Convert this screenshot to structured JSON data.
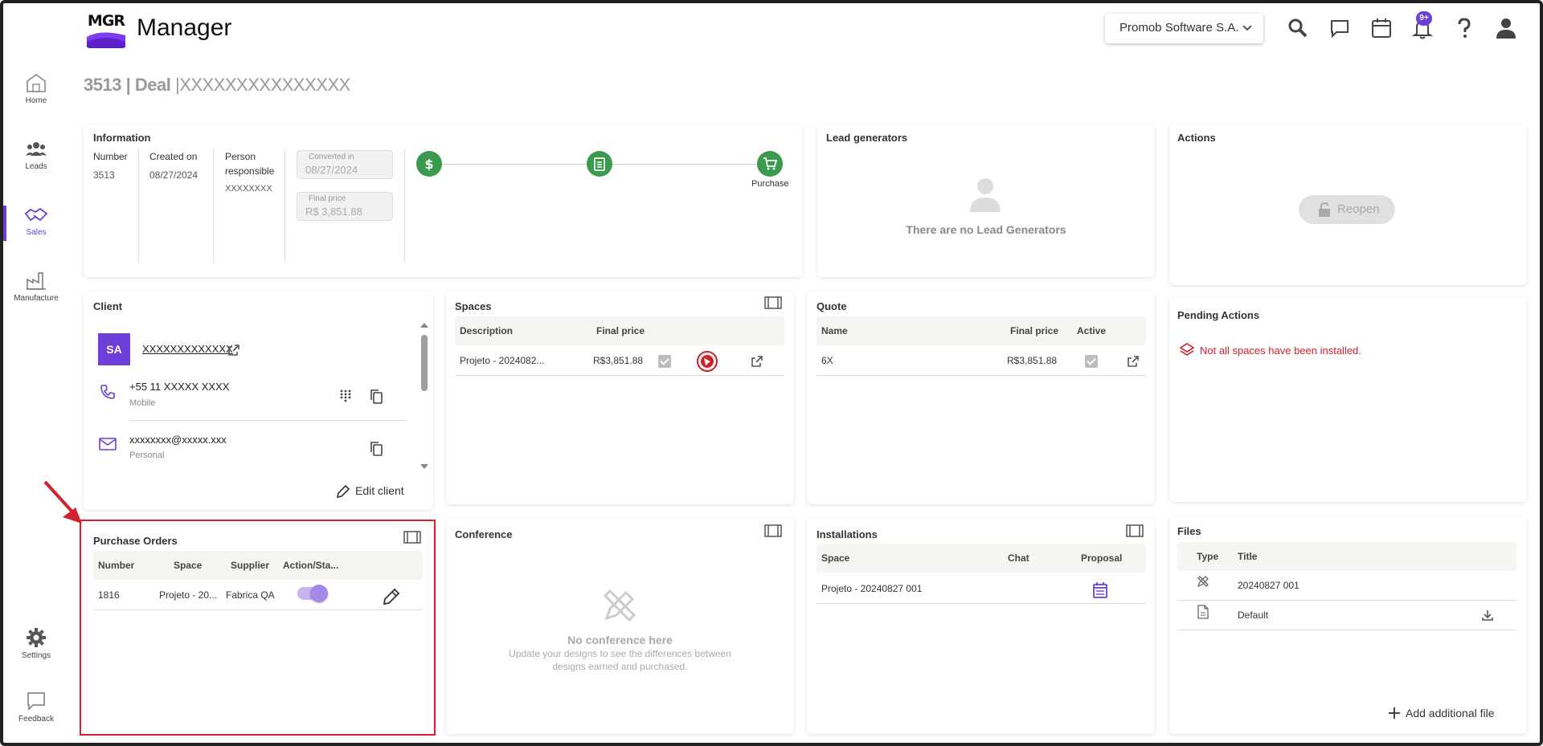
{
  "header": {
    "logo_text": "MGR",
    "app_title": "Manager",
    "company": "Promob Software S.A.",
    "notifications_badge": "9+"
  },
  "nav": [
    {
      "label": "Home",
      "icon": "home-icon"
    },
    {
      "label": "Leads",
      "icon": "people-icon"
    },
    {
      "label": "Sales",
      "icon": "handshake-icon"
    },
    {
      "label": "Manufacture",
      "icon": "factory-icon"
    },
    {
      "label": "Settings",
      "icon": "gear-icon"
    },
    {
      "label": "Feedback",
      "icon": "feedback-icon"
    }
  ],
  "page": {
    "number": "3513",
    "sep1": "|",
    "type": "Deal",
    "sep2": "|",
    "name": "XXXXXXXXXXXXXXX"
  },
  "information": {
    "title": "Information",
    "number_label": "Number",
    "number_value": "3513",
    "created_label": "Created on",
    "created_value": "08/27/2024",
    "person_label_1": "Person",
    "person_label_2": "responsible",
    "person_value": "XXXXXXXX",
    "converted_label": "Converted in",
    "converted_value": "08/27/2024",
    "final_price_label": "Final price",
    "final_price_value": "R$ 3,851.88",
    "step_purchase": "Purchase"
  },
  "lead_generators": {
    "title": "Lead generators",
    "empty": "There are no Lead Generators"
  },
  "actions": {
    "title": "Actions",
    "reopen": "Reopen"
  },
  "client": {
    "title": "Client",
    "avatar": "SA",
    "name": "XXXXXXXXXXXXX",
    "phone": "+55 11 XXXXX XXXX",
    "phone_type": "Mobile",
    "email": "xxxxxxxx@xxxxx.xxx",
    "email_type": "Personal",
    "edit": "Edit client"
  },
  "spaces": {
    "title": "Spaces",
    "col_description": "Description",
    "col_final_price": "Final price",
    "row_description": "Projeto - 2024082...",
    "row_price": "R$3,851.88"
  },
  "quote": {
    "title": "Quote",
    "col_name": "Name",
    "col_final_price": "Final price",
    "col_active": "Active",
    "row_name": "6X",
    "row_price": "R$3,851.88"
  },
  "pending": {
    "title": "Pending Actions",
    "message": "Not all spaces have been installed."
  },
  "purchase_orders": {
    "title": "Purchase Orders",
    "col_number": "Number",
    "col_space": "Space",
    "col_supplier": "Supplier",
    "col_action": "Action/Sta...",
    "row_number": "1816",
    "row_space": "Projeto - 20...",
    "row_supplier": "Fabrica QA",
    "toggle_on": true
  },
  "conference": {
    "title": "Conference",
    "empty_title": "No conference here",
    "empty_line1": "Update your designs to see the differences between",
    "empty_line2": "designs earned and purchased."
  },
  "installations": {
    "title": "Installations",
    "col_space": "Space",
    "col_chat": "Chat",
    "col_proposal": "Proposal",
    "row_space": "Projeto - 20240827 001"
  },
  "files": {
    "title": "Files",
    "col_type": "Type",
    "col_title": "Title",
    "row1_title": "20240827 001",
    "row2_title": "Default",
    "add": "Add additional file"
  },
  "colors": {
    "accent": "#6b3fd8",
    "success": "#3a9a4e",
    "danger": "#d0212c"
  }
}
